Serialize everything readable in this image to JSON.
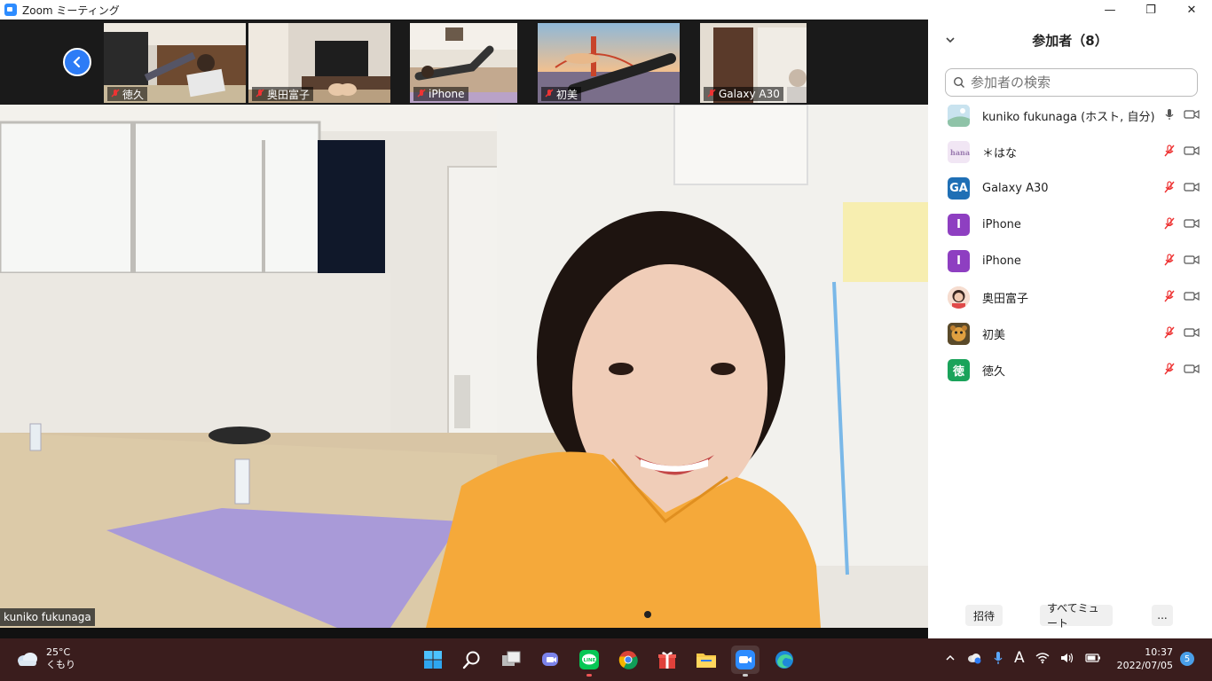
{
  "window": {
    "title": "Zoom ミーティング",
    "controls": [
      "—",
      "❐",
      "✕"
    ]
  },
  "thumbnails": [
    {
      "name": "徳久",
      "muted": true
    },
    {
      "name": "奥田富子",
      "muted": true
    },
    {
      "name": "iPhone",
      "muted": true
    },
    {
      "name": "初美",
      "muted": true
    },
    {
      "name": "Galaxy A30",
      "muted": true
    }
  ],
  "main_video": {
    "name": "kuniko fukunaga"
  },
  "participants_panel": {
    "title": "参加者（8）",
    "search_placeholder": "参加者の検索",
    "participants": [
      {
        "name": "kuniko fukunaga (ホスト, 自分)",
        "avatar_text": "",
        "avatar_color": "#b8d8e8",
        "mic_muted": false
      },
      {
        "name": "＊はな",
        "avatar_text": "",
        "avatar_color": "#efe3f2",
        "mic_muted": true
      },
      {
        "name": "Galaxy A30",
        "avatar_text": "GA",
        "avatar_color": "#1f6fb5",
        "mic_muted": true
      },
      {
        "name": "iPhone",
        "avatar_text": "I",
        "avatar_color": "#8e3fc1",
        "mic_muted": true
      },
      {
        "name": "iPhone",
        "avatar_text": "I",
        "avatar_color": "#8e3fc1",
        "mic_muted": true
      },
      {
        "name": "奥田富子",
        "avatar_text": "",
        "avatar_color": "#e8c0a8",
        "mic_muted": true
      },
      {
        "name": "初美",
        "avatar_text": "",
        "avatar_color": "#8a6a3a",
        "mic_muted": true
      },
      {
        "name": "徳久",
        "avatar_text": "徳",
        "avatar_color": "#1aa35a",
        "mic_muted": true
      }
    ],
    "footer": {
      "invite": "招待",
      "mute_all": "すべてミュート",
      "more": "..."
    }
  },
  "taskbar": {
    "weather_temp": "25°C",
    "weather_desc": "くもり",
    "clock_time": "10:37",
    "clock_date": "2022/07/05",
    "notification_count": "5",
    "ime": "A"
  }
}
